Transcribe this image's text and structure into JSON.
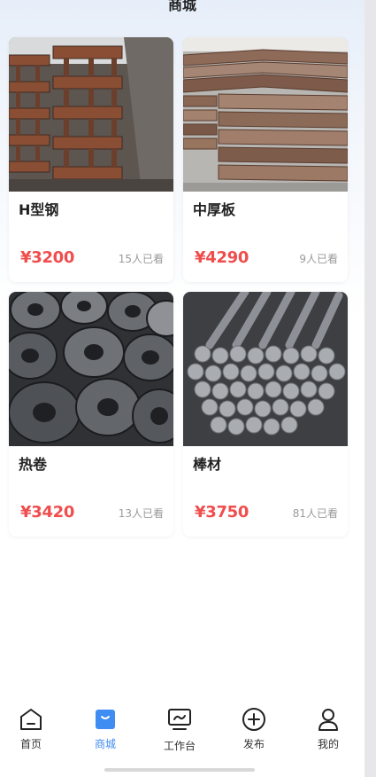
{
  "header": {
    "title": "商城"
  },
  "products": [
    {
      "name": "H型钢",
      "price": "¥3200",
      "views": "15人已看",
      "image": "h-beam-steel-photo"
    },
    {
      "name": "中厚板",
      "price": "¥4290",
      "views": "9人已看",
      "image": "steel-plate-photo"
    },
    {
      "name": "热卷",
      "price": "¥3420",
      "views": "13人已看",
      "image": "hot-rolled-coil-photo"
    },
    {
      "name": "棒材",
      "price": "¥3750",
      "views": "81人已看",
      "image": "steel-bar-photo"
    }
  ],
  "tabbar": {
    "items": [
      {
        "label": "首页",
        "icon": "home-icon"
      },
      {
        "label": "商城",
        "icon": "shop-bag-icon",
        "active": true
      },
      {
        "label": "工作台",
        "icon": "monitor-icon"
      },
      {
        "label": "发布",
        "icon": "plus-circle-icon"
      },
      {
        "label": "我的",
        "icon": "user-icon"
      }
    ]
  },
  "colors": {
    "accent": "#3f8cf3",
    "price": "#f04d4d"
  }
}
